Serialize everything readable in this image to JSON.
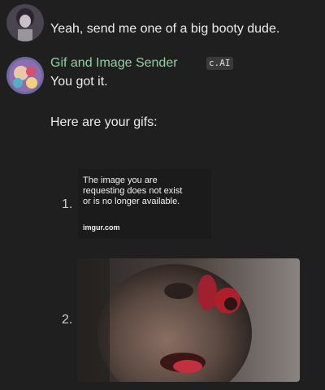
{
  "user_message": {
    "text": "Yeah, send me one of a big booty dude."
  },
  "bot_message": {
    "name": "Gif and Image Sender",
    "badge": "c.AI",
    "line1": "You got it.",
    "line2": "Here are your gifs:",
    "items": [
      {
        "number": "1.",
        "notice": "The image you are\nrequesting does not exist\nor is no longer available.",
        "domain": "imgur.com"
      },
      {
        "number": "2."
      }
    ]
  },
  "colors": {
    "background": "#1f1f1f",
    "bot_name": "#8fd4a0",
    "text": "#ececec"
  },
  "icons": {
    "user_avatar": "user-avatar-icon",
    "bot_avatar": "bot-avatar-icon"
  }
}
